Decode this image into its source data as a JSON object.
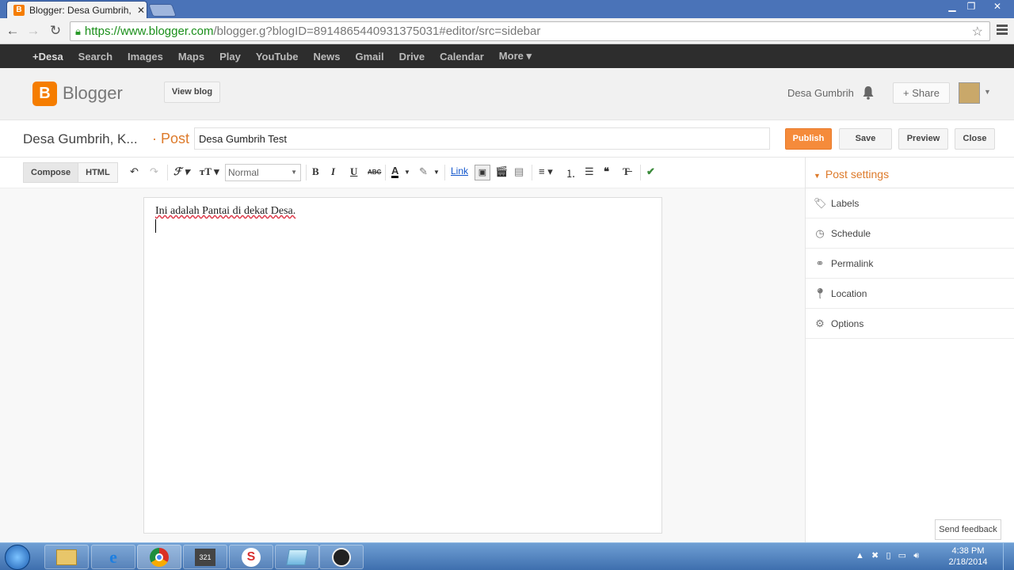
{
  "browser": {
    "tab_title": "Blogger: Desa Gumbrih, K",
    "favicon": "B",
    "tab_close": "✕",
    "url_host": "https://www.blogger.com",
    "url_rest": "/blogger.g?blogID=8914865440931375031#editor/src=sidebar"
  },
  "gbar": {
    "items": [
      "+Desa",
      "Search",
      "Images",
      "Maps",
      "Play",
      "YouTube",
      "News",
      "Gmail",
      "Drive",
      "Calendar",
      "More ▾"
    ]
  },
  "header": {
    "logo_letter": "B",
    "app_name": "Blogger",
    "view_blog": "View blog",
    "username": "Desa Gumbrih",
    "share": "+ Share"
  },
  "post": {
    "blog_title": "Desa Gumbrih, K...",
    "post_tag": "· Post",
    "title_value": "Desa Gumbrih Test",
    "publish": "Publish",
    "save": "Save",
    "preview": "Preview",
    "close": "Close"
  },
  "toolbar": {
    "compose": "Compose",
    "html": "HTML",
    "format_select": "Normal",
    "link": "Link"
  },
  "editor": {
    "body_text": "Ini adalah Pantai di dekat Desa."
  },
  "sidebar": {
    "heading": "Post settings",
    "items": [
      {
        "label": "Labels",
        "icon": "tag-icon"
      },
      {
        "label": "Schedule",
        "icon": "clock-icon"
      },
      {
        "label": "Permalink",
        "icon": "link-icon"
      },
      {
        "label": "Location",
        "icon": "location-pin-icon"
      },
      {
        "label": "Options",
        "icon": "gear-icon"
      }
    ]
  },
  "feedback": "Send feedback",
  "taskbar": {
    "time": "4:38 PM",
    "date": "2/18/2014"
  },
  "colors": {
    "blogger_orange": "#f57d00",
    "publish_orange": "#f58b3b",
    "gbar_bg": "#2d2d2d"
  }
}
